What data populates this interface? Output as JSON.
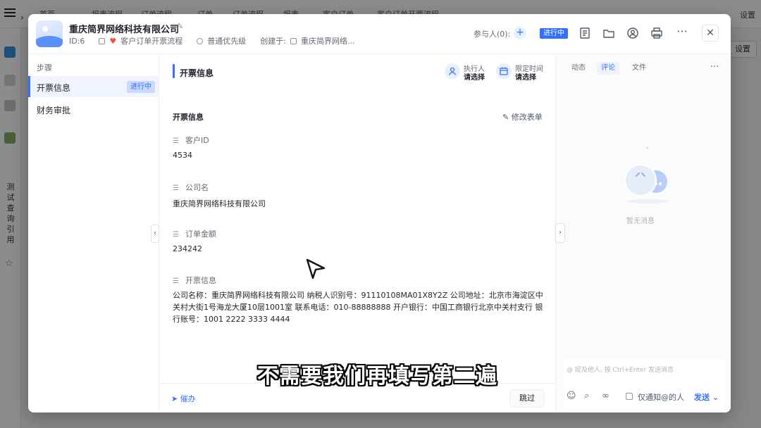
{
  "background": {
    "tabs": [
      "首页",
      "报表流程",
      "订单流程",
      "订单",
      "订单流程",
      "报表",
      "客户订单",
      "客户订单开票流程"
    ],
    "side_text": "测试查询引用",
    "right_top": "设置",
    "right_button": "设置"
  },
  "header": {
    "title": "重庆简界网络科技有限公司",
    "id_text": "ID:6",
    "flow_name": "客户订单开票流程",
    "priority": "普通优先级",
    "creator_label": "创建于:",
    "creator_value": "重庆简界网络...",
    "participants": "参与人(0):",
    "status": "进行中"
  },
  "steps": {
    "heading": "步骤",
    "items": [
      {
        "label": "开票信息",
        "badge": "进行中"
      },
      {
        "label": "财务审批",
        "badge": ""
      }
    ]
  },
  "form": {
    "heading": "开票信息",
    "assignee_label": "执行人",
    "assignee_value": "请选择",
    "deadline_label": "限定时间",
    "deadline_value": "请选择",
    "section_title": "开票信息",
    "edit_label": "修改表单",
    "fields": [
      {
        "label": "客户ID",
        "value": "4534"
      },
      {
        "label": "公司名",
        "value": "重庆简界网络科技有限公司"
      },
      {
        "label": "订单金额",
        "value": "234242"
      },
      {
        "label": "开票信息",
        "value": "公司名称：重庆简界网络科技有限公司 纳税人识别号：91110108MA01X8Y2Z 公司地址：北京市海淀区中关村大街1号海龙大厦10层1001室 联系电话：010-88888888 开户银行：中国工商银行北京中关村支行 银行账号：1001 2222 3333 4444"
      }
    ],
    "urge_label": "催办",
    "skip_label": "跳过"
  },
  "comments": {
    "tabs": [
      "动态",
      "评论",
      "文件"
    ],
    "active_tab": 1,
    "empty_text": "暂无消息",
    "input_placeholder": "@ 提及他人, 按 Ctrl+Enter 发送消息",
    "notify_label": "仅通知@的人",
    "send_label": "发送"
  },
  "caption": "不需要我们再填写第二遍",
  "colors": {
    "accent": "#3370ff",
    "heart": "#f54a45"
  }
}
